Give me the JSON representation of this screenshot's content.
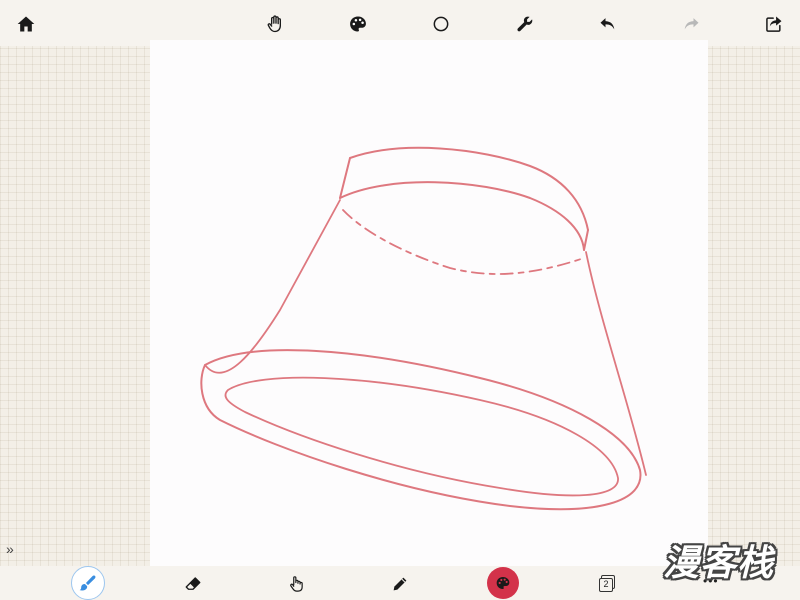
{
  "toolbar_top": {
    "icons": [
      "home-icon",
      "hand-icon",
      "palette-icon",
      "circle-icon",
      "wrench-icon",
      "undo-icon",
      "redo-icon",
      "share-icon"
    ]
  },
  "toolbar_bottom": {
    "icons": [
      "brush-icon",
      "eraser-icon",
      "smudge-icon",
      "pencil-icon",
      "color-icon",
      "layers-icon",
      "more-icon"
    ],
    "layer_count": "2",
    "more_label": "•••",
    "expand_label": "»"
  },
  "watermark": {
    "text": "漫客栈"
  },
  "colors": {
    "accent_blue": "#9cc6ef",
    "active_color": "#d3324a",
    "stroke_color": "#d9616a",
    "canvas_bg": "#fdfcfd",
    "workspace_bg": "#f3efe7"
  }
}
